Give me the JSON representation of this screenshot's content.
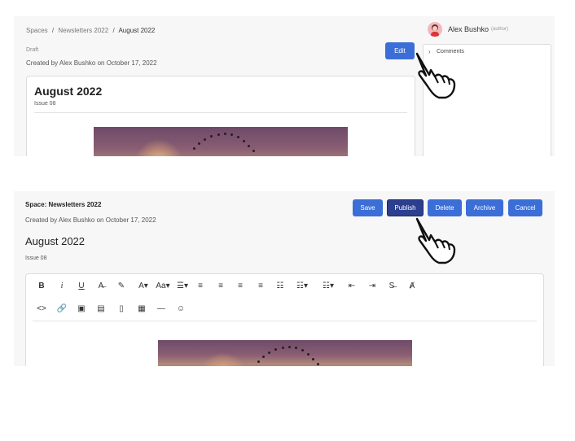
{
  "view": {
    "breadcrumb": [
      "Spaces",
      "Newsletters 2022",
      "August 2022"
    ],
    "breadcrumb_sep": "/",
    "status": "Draft",
    "created": "Created by Alex Bushko on October 17, 2022",
    "edit_label": "Edit",
    "user_name": "Alex Bushko",
    "user_role": "(author)",
    "comments_label": "Comments",
    "doc_title": "August 2022",
    "doc_subtitle": "Issue 08"
  },
  "edit": {
    "space_label": "Space: Newsletters 2022",
    "created": "Created by Alex Bushko on October 17, 2022",
    "title": "August 2022",
    "subtitle": "Issue 08",
    "buttons": {
      "save": "Save",
      "publish": "Publish",
      "delete": "Delete",
      "archive": "Archive",
      "cancel": "Cancel"
    },
    "toolbar_row1": [
      "B",
      "i",
      "U",
      "A̶",
      "✎",
      "A▾",
      "Aa▾",
      "☰▾",
      "≡",
      "≡",
      "≡",
      "≡",
      "☷",
      "☷▾",
      "☷▾",
      "⇤",
      "⇥",
      "S̶",
      "Ⱥ"
    ],
    "toolbar_row2": [
      "<>",
      "🔗",
      "▣",
      "▤",
      "▯",
      "▦",
      "—",
      "☺"
    ]
  },
  "colors": {
    "accent": "#3b6ed6",
    "accent_active": "#2c3f8f"
  }
}
